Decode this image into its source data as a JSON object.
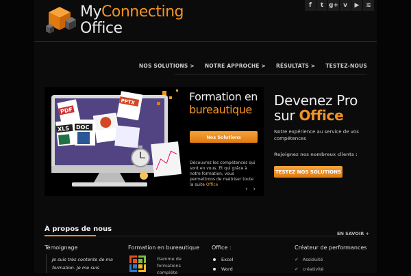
{
  "brand": {
    "line1_prefix": "My",
    "line1_accent": "Connecting",
    "line2": "Office",
    "accent_color": "#f39323"
  },
  "social": [
    {
      "icon": "facebook-icon",
      "glyph": "f"
    },
    {
      "icon": "twitter-icon",
      "glyph": "t"
    },
    {
      "icon": "google-plus-icon",
      "glyph": "g+"
    },
    {
      "icon": "vimeo-icon",
      "glyph": "v"
    },
    {
      "icon": "youtube-icon",
      "glyph": "▶"
    },
    {
      "icon": "rss-icon",
      "glyph": "≋"
    }
  ],
  "nav": [
    "NOS SOLUTIONS >",
    "NOTRE APPROCHE >",
    "RÉSULTATS >",
    "TESTEZ-NOUS"
  ],
  "slider": {
    "title_line1": "Formation en",
    "title_line2": "bureautique",
    "button": "Nos Solutions",
    "desc": "Découvrez les compétences qui sont en vous. Et qui grâce à notre formation, vous permettrons de maitriser toute la suite",
    "desc_accent": "Office",
    "prev": "‹",
    "next": "›",
    "doc_labels": [
      "PDF",
      "PPTX",
      "XLS",
      "DOC"
    ]
  },
  "hero": {
    "title_line1": "Devenez Pro",
    "title_line2_prefix": "sur",
    "title_line2_accent": "Office",
    "subtitle": "Notre expérience au service de vos compétences",
    "join": "Rejoignez nos nombreux clients :",
    "button": "TESTEZ NOS SOLUTIONS"
  },
  "about": {
    "title": "À propos de nous",
    "more": "EN SAVOIR +",
    "col1_title": "Témoignage",
    "col1_text": "Je suis très contente de ma formation. Je me suis",
    "col2_title": "Formation en bureautique",
    "col2_text": "Gamme de formations complète",
    "col3_title": "Office :",
    "col3_items": [
      "Excel",
      "Word"
    ],
    "col4_title": "Créateur de performances",
    "col4_items": [
      "Assiduité",
      "créativité"
    ]
  }
}
